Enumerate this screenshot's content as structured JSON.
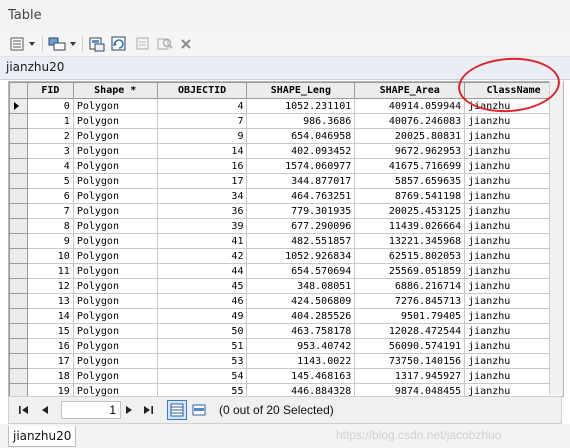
{
  "window": {
    "title": "Table"
  },
  "toolbar": {
    "buttons": [
      "table-options-icon",
      "related-tables-icon",
      "select-by-attributes-icon",
      "switch-selection-icon",
      "clear-selection-icon",
      "zoom-to-selected-icon",
      "delete-selected-icon"
    ]
  },
  "layer": {
    "name": "jianzhu20"
  },
  "table": {
    "columns": [
      "FID",
      "Shape *",
      "OBJECTID",
      "SHAPE_Leng",
      "SHAPE_Area",
      "ClassName"
    ],
    "rows": [
      [
        "0",
        "Polygon",
        "4",
        "1052.231101",
        "40914.059944",
        "jianzhu"
      ],
      [
        "1",
        "Polygon",
        "7",
        "986.3686",
        "40076.246083",
        "jianzhu"
      ],
      [
        "2",
        "Polygon",
        "9",
        "654.046958",
        "20025.80831",
        "jianzhu"
      ],
      [
        "3",
        "Polygon",
        "14",
        "402.093452",
        "9672.962953",
        "jianzhu"
      ],
      [
        "4",
        "Polygon",
        "16",
        "1574.060977",
        "41675.716699",
        "jianzhu"
      ],
      [
        "5",
        "Polygon",
        "17",
        "344.877017",
        "5857.659635",
        "jianzhu"
      ],
      [
        "6",
        "Polygon",
        "34",
        "464.763251",
        "8769.541198",
        "jianzhu"
      ],
      [
        "7",
        "Polygon",
        "36",
        "779.301935",
        "20025.453125",
        "jianzhu"
      ],
      [
        "8",
        "Polygon",
        "39",
        "677.290096",
        "11439.026664",
        "jianzhu"
      ],
      [
        "9",
        "Polygon",
        "41",
        "482.551857",
        "13221.345968",
        "jianzhu"
      ],
      [
        "10",
        "Polygon",
        "42",
        "1052.926834",
        "62515.802053",
        "jianzhu"
      ],
      [
        "11",
        "Polygon",
        "44",
        "654.570694",
        "25569.051859",
        "jianzhu"
      ],
      [
        "12",
        "Polygon",
        "45",
        "348.08051",
        "6886.216714",
        "jianzhu"
      ],
      [
        "13",
        "Polygon",
        "46",
        "424.506809",
        "7276.845713",
        "jianzhu"
      ],
      [
        "14",
        "Polygon",
        "49",
        "404.285526",
        "9501.79405",
        "jianzhu"
      ],
      [
        "15",
        "Polygon",
        "50",
        "463.758178",
        "12028.472544",
        "jianzhu"
      ],
      [
        "16",
        "Polygon",
        "51",
        "953.40742",
        "56090.574191",
        "jianzhu"
      ],
      [
        "17",
        "Polygon",
        "53",
        "1143.0022",
        "73750.140156",
        "jianzhu"
      ],
      [
        "18",
        "Polygon",
        "54",
        "145.468163",
        "1317.945927",
        "jianzhu"
      ],
      [
        "19",
        "Polygon",
        "55",
        "446.884328",
        "9874.048455",
        "jianzhu"
      ]
    ]
  },
  "navigation": {
    "current_record": "1"
  },
  "status": {
    "selection_text": "(0 out of 20 Selected)"
  },
  "bottom_tab": {
    "label": "jianzhu20"
  },
  "watermark": {
    "text": "https://blog.csdn.net/jacobzhuo"
  },
  "colors": {
    "annotation_ellipse": "#e0242b",
    "active_view_border": "#3a78c8"
  }
}
